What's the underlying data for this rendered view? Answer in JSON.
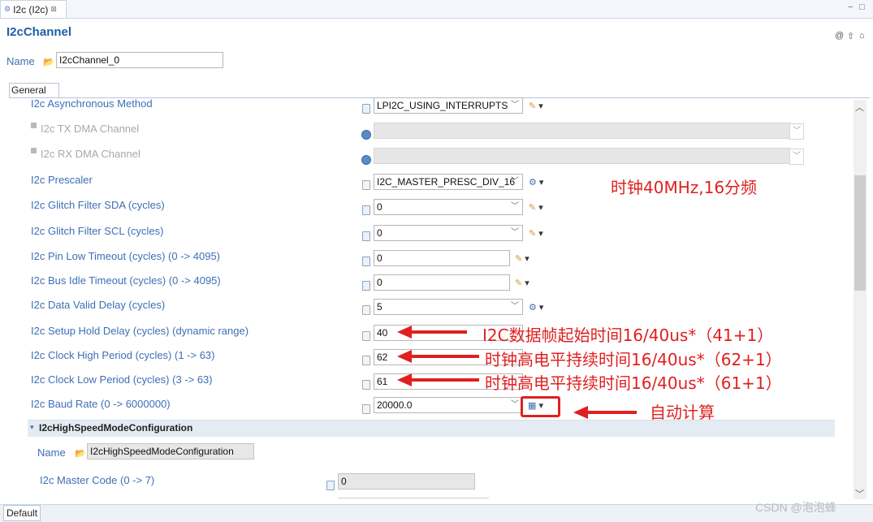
{
  "editor_tab": {
    "label": "I2c (I2c)",
    "close": "⊠"
  },
  "window_buttons": {
    "min": "−",
    "max": "□"
  },
  "page": {
    "title": "I2cChannel",
    "name_label": "Name",
    "name_value": "I2cChannel_0"
  },
  "header_icons": {
    "a": "@",
    "b": "⇧",
    "c": "⌂"
  },
  "general_tab": "General",
  "default_tab": "Default",
  "rows": {
    "async": {
      "label": "I2c Asynchronous Method",
      "value": "LPI2C_USING_INTERRUPTS"
    },
    "txdma": {
      "label": "I2c TX DMA Channel"
    },
    "rxdma": {
      "label": "I2c RX DMA Channel"
    },
    "prescaler": {
      "label": "I2c Prescaler",
      "value": "I2C_MASTER_PRESC_DIV_16"
    },
    "glitch_sda": {
      "label": "I2c Glitch Filter SDA (cycles)",
      "value": "0"
    },
    "glitch_scl": {
      "label": "I2c Glitch Filter SCL (cycles)",
      "value": "0"
    },
    "pin_low": {
      "label": "I2c Pin Low Timeout (cycles) (0 -> 4095)",
      "value": "0"
    },
    "bus_idle": {
      "label": "I2c Bus Idle Timeout (cycles) (0 -> 4095)",
      "value": "0"
    },
    "data_valid": {
      "label": "I2c Data Valid Delay (cycles)",
      "value": "5"
    },
    "setup_hold": {
      "label": "I2c Setup Hold Delay (cycles) (dynamic range)",
      "value": "40"
    },
    "clock_high": {
      "label": "I2c Clock High Period (cycles) (1 -> 63)",
      "value": "62"
    },
    "clock_low": {
      "label": "I2c Clock Low Period (cycles) (3 -> 63)",
      "value": "61"
    },
    "baud": {
      "label": "I2c Baud Rate (0 -> 6000000)",
      "value": "20000.0"
    }
  },
  "highspeed": {
    "section_title": "I2cHighSpeedModeConfiguration",
    "name_label": "Name",
    "name_value": "I2cHighSpeedModeConfiguration",
    "master_code_label": "I2c Master Code (0 -> 7)",
    "master_code_value": "0"
  },
  "annotations": {
    "clock": "时钟40MHz,16分频",
    "setup": "I2C数据帧起始时间16/40us*（41+1）",
    "high": "时钟高电平持续时间16/40us*（62+1）",
    "low": "时钟高电平持续时间16/40us*（61+1）",
    "auto": "自动计算"
  },
  "watermark": "CSDN @泡泡蜂",
  "colors": {
    "label_blue": "#3d6fb6",
    "annotation_red": "#e02020",
    "title_blue": "#1f5ea8"
  }
}
